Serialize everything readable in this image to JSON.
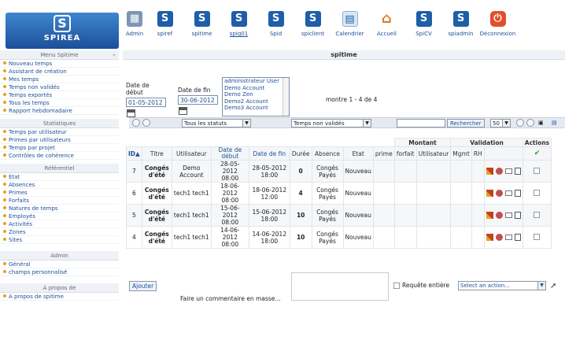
{
  "brand": {
    "name": "SPIREA",
    "mark": "S"
  },
  "apps": [
    {
      "label": "Admin",
      "icon": "admin-icon",
      "glyph": "▦"
    },
    {
      "label": "spiref",
      "icon": "spiref-icon",
      "glyph": "S"
    },
    {
      "label": "spitime",
      "icon": "spitime-icon",
      "glyph": "S"
    },
    {
      "label": "spig01",
      "icon": "spig01-icon",
      "glyph": "S"
    },
    {
      "label": "Spid",
      "icon": "spid-icon",
      "glyph": "S"
    },
    {
      "label": "spiclient",
      "icon": "spiclient-icon",
      "glyph": "S"
    },
    {
      "label": "Calendrier",
      "icon": "calendar-icon",
      "glyph": "▤"
    },
    {
      "label": "Accueil",
      "icon": "home-icon",
      "glyph": "⌂"
    },
    {
      "label": "SpiCV",
      "icon": "spicv-icon",
      "glyph": "S"
    },
    {
      "label": "spiadmin",
      "icon": "spiadmin-icon",
      "glyph": "S"
    },
    {
      "label": "Déconnexion",
      "icon": "power-icon",
      "glyph": "⏻"
    }
  ],
  "sidebar": {
    "menu_title": "Menu Spitime",
    "collapse": "«",
    "menu": [
      "Nouveau temps",
      "Assistant de création",
      "Mes temps",
      "Temps non validés",
      "Temps exportés",
      "Tous les temps",
      "Rapport hebdomadaire"
    ],
    "stats_title": "Statistiques",
    "stats": [
      "Temps par utilisateur",
      "Primes par utilisateurs",
      "Temps par projet",
      "Contrôles de cohérence"
    ],
    "ref_title": "Référentiel",
    "ref": [
      "Etat",
      "Absences",
      "Primes",
      "Forfaits",
      "Natures de temps",
      "Employés",
      "Activités",
      "Zones",
      "Sites"
    ],
    "admin_title": "Admin",
    "admin": [
      "Général",
      "champs personnalisé"
    ],
    "about_title": "A propos de",
    "about": [
      "A propos de spitime"
    ]
  },
  "main": {
    "title": "spitime",
    "filters": {
      "start_label_1": "Date de",
      "start_label_2": "début",
      "start_value": "01-05-2012",
      "end_label": "Date de fin",
      "end_value": "30-06-2012",
      "users": [
        "administrateur User",
        "Demo Account",
        "Demo Zen",
        "Demo2 Account",
        "Demo3 Account"
      ],
      "count_text": "montre 1 - 4 de 4"
    },
    "toolbar": {
      "status_filter": "Tous les statuts",
      "validation_filter": "Temps non validés",
      "search_button": "Rechercher",
      "page_size": "50"
    },
    "table": {
      "group_headers": {
        "montant": "Montant",
        "validation": "Validation",
        "actions": "Actions"
      },
      "headers": {
        "id": "ID",
        "sort_mark": "▲",
        "titre": "Titre",
        "utilisateur": "Utilisateur",
        "date_debut": "Date de début",
        "date_fin": "Date de fin",
        "duree": "Durée",
        "absence": "Absence",
        "etat": "Etat",
        "prime": "prime",
        "forfait": "forfait",
        "utilisateur_v": "Utilisateur",
        "mgmt": "Mgmt",
        "rh": "RH"
      },
      "rows": [
        {
          "id": "7",
          "titre": "Congés d'été",
          "user": "Demo Account",
          "start": "28-05-2012 08:00",
          "end": "28-05-2012 18:00",
          "duree": "0",
          "absence": "Congés Payés",
          "etat": "Nouveau"
        },
        {
          "id": "6",
          "titre": "Congés d'été",
          "user": "tech1 tech1",
          "start": "18-06-2012 08:00",
          "end": "18-06-2012 12:00",
          "duree": "4",
          "absence": "Congés Payés",
          "etat": "Nouveau"
        },
        {
          "id": "5",
          "titre": "Congés d'été",
          "user": "tech1 tech1",
          "start": "15-06-2012 08:00",
          "end": "15-06-2012 18:00",
          "duree": "10",
          "absence": "Congés Payés",
          "etat": "Nouveau"
        },
        {
          "id": "4",
          "titre": "Congés d'été",
          "user": "tech1 tech1",
          "start": "14-06-2012 08:00",
          "end": "14-06-2012 18:00",
          "duree": "10",
          "absence": "Congés Payés",
          "etat": "Nouveau"
        }
      ]
    },
    "footer": {
      "add_button": "Ajouter",
      "comment_label": "Faire un commentaire en masse...",
      "full_request_label": "Requête entière",
      "action_placeholder": "Select an action..."
    }
  }
}
